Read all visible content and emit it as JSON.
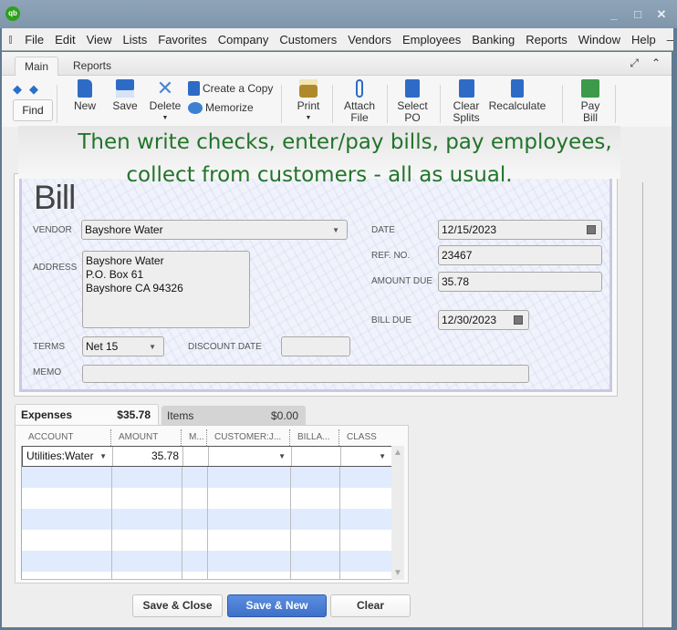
{
  "window": {
    "logo_text": "qb",
    "controls": [
      "_",
      "□",
      "✕"
    ]
  },
  "menubar": {
    "items": [
      "File",
      "Edit",
      "View",
      "Lists",
      "Favorites",
      "Company",
      "Customers",
      "Vendors",
      "Employees",
      "Banking",
      "Reports",
      "Window",
      "Help"
    ],
    "minimize": "–"
  },
  "tabs": {
    "main": "Main",
    "reports": "Reports",
    "expand_icon": "⤢",
    "collapse_icon": "⌃"
  },
  "toolbar": {
    "find": "Find",
    "new": "New",
    "save": "Save",
    "delete": "Delete",
    "create_copy": "Create a Copy",
    "memorize": "Memorize",
    "print": "Print",
    "attach_file_1": "Attach",
    "attach_file_2": "File",
    "select_po_1": "Select",
    "select_po_2": "PO",
    "clear_splits_1": "Clear",
    "clear_splits_2": "Splits",
    "recalculate": "Recalculate",
    "pay_bill_1": "Pay",
    "pay_bill_2": "Bill"
  },
  "banner": {
    "line1": "Then write checks, enter/pay bills, pay employees,",
    "line2": "collect from customers - all as usual."
  },
  "bill": {
    "title": "Bill",
    "vendor_label": "VENDOR",
    "vendor": "Bayshore Water",
    "address_label": "ADDRESS",
    "address": "Bayshore Water\nP.O. Box 61\nBayshore CA 94326",
    "date_label": "DATE",
    "date": "12/15/2023",
    "ref_label": "REF. NO.",
    "ref_no": "23467",
    "amount_due_label": "AMOUNT DUE",
    "amount_due": "35.78",
    "bill_due_label": "BILL DUE",
    "bill_due": "12/30/2023",
    "terms_label": "TERMS",
    "terms": "Net 15",
    "discount_date_label": "DISCOUNT DATE",
    "discount_date": "",
    "memo_label": "MEMO",
    "memo": ""
  },
  "split_tabs": {
    "expenses_label": "Expenses",
    "expenses_amount": "$35.78",
    "items_label": "Items",
    "items_amount": "$0.00"
  },
  "grid": {
    "columns": [
      "ACCOUNT",
      "AMOUNT",
      "M...",
      "CUSTOMER:J...",
      "BILLA...",
      "CLASS"
    ],
    "rows": [
      {
        "account": "Utilities:Water",
        "amount": "35.78",
        "memo": "",
        "customer": "",
        "billable": "",
        "class": ""
      }
    ]
  },
  "buttons": {
    "save_close": "Save & Close",
    "save_new": "Save & New",
    "clear": "Clear"
  }
}
